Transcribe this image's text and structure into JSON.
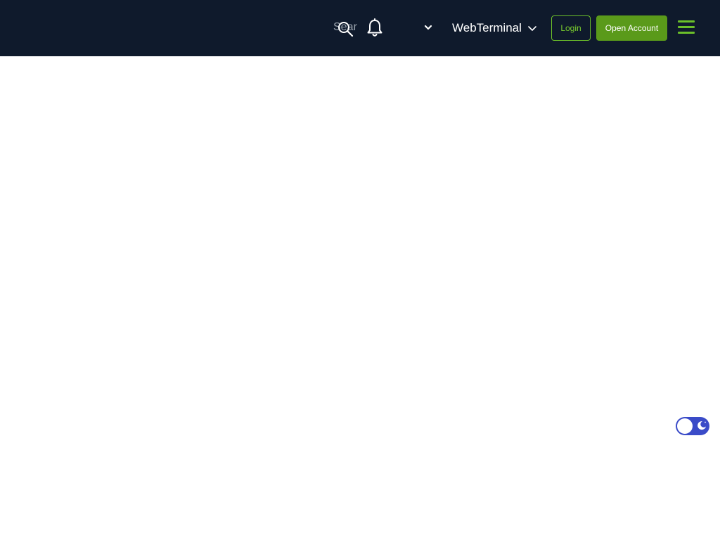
{
  "header": {
    "search": {
      "text": "Sear",
      "icon": "search-icon"
    },
    "notifications": {
      "icon": "bell-icon"
    },
    "language": {
      "icon": "chevron-down-icon"
    },
    "webterminal": {
      "label": "WebTerminal",
      "icon": "chevron-down-icon"
    },
    "login_label": "Login",
    "open_account_label": "Open Account",
    "menu": {
      "icon": "hamburger-menu-icon"
    }
  },
  "theme_toggle": {
    "mode": "dark",
    "icon": "moon-icon"
  },
  "colors": {
    "header_bg": "#0f1a2c",
    "accent_green": "#6bbf2a",
    "button_green": "#5a9a1a",
    "toggle_blue": "#3a4bc8",
    "page_bg": "#ffffff"
  }
}
